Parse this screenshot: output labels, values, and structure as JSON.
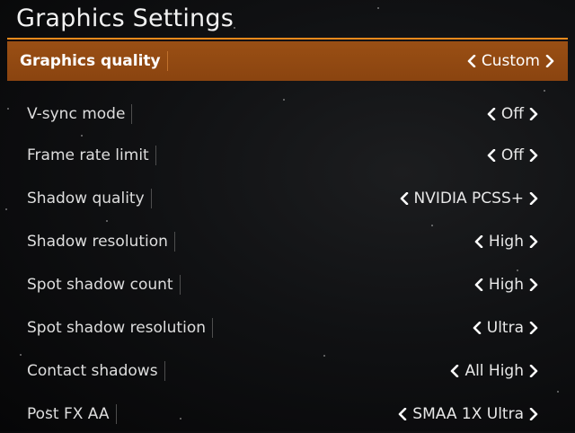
{
  "page": {
    "title": "Graphics Settings"
  },
  "colors": {
    "accent": "#f08a1c",
    "selected_row_bg": "#8f4812",
    "text": "#e6e6e6"
  },
  "icons": {
    "previous": "chevron-left-icon",
    "next": "chevron-right-icon"
  },
  "settings": [
    {
      "label": "Graphics quality",
      "value": "Custom",
      "selected": true
    },
    {
      "label": "V-sync mode",
      "value": "Off"
    },
    {
      "label": "Frame rate limit",
      "value": "Off"
    },
    {
      "label": "Shadow quality",
      "value": "NVIDIA PCSS+"
    },
    {
      "label": "Shadow resolution",
      "value": "High"
    },
    {
      "label": "Spot shadow count",
      "value": "High"
    },
    {
      "label": "Spot shadow resolution",
      "value": "Ultra"
    },
    {
      "label": "Contact shadows",
      "value": "All High"
    },
    {
      "label": "Post FX AA",
      "value": "SMAA 1X Ultra"
    }
  ]
}
